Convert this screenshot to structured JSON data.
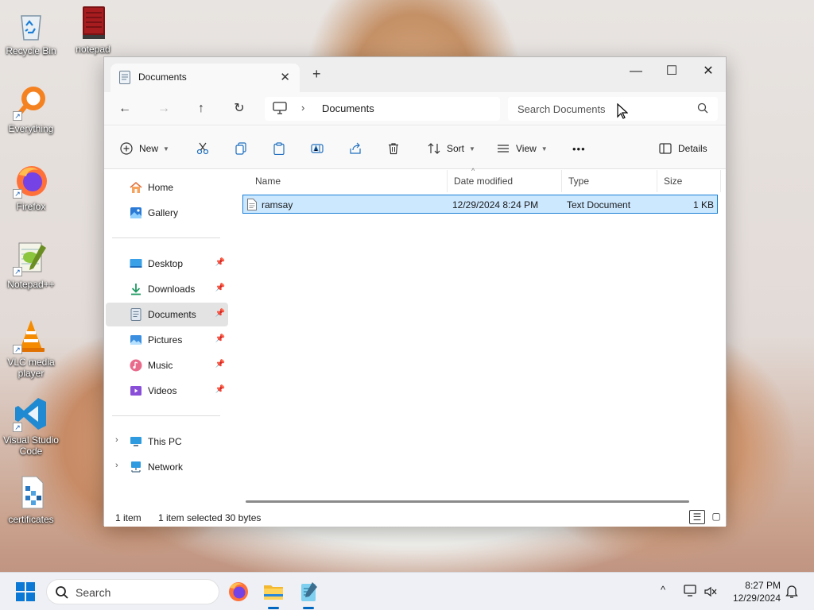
{
  "desktop": {
    "icons": [
      {
        "label": "Recycle Bin",
        "icon": "recycle-bin-icon"
      },
      {
        "label": "notepad",
        "icon": "notepad-book-icon"
      },
      {
        "label": "Everything",
        "icon": "everything-search-icon"
      },
      {
        "label": "Firefox",
        "icon": "firefox-icon"
      },
      {
        "label": "Notepad++",
        "icon": "notepadpp-icon"
      },
      {
        "label": "VLC media player",
        "icon": "vlc-cone-icon"
      },
      {
        "label": "Visual Studio Code",
        "icon": "vscode-icon"
      },
      {
        "label": "certificates",
        "icon": "certificates-icon"
      }
    ]
  },
  "window": {
    "tab_title": "Documents",
    "controls": {
      "minimize": "—",
      "maximize": "☐",
      "close": "✕"
    },
    "address": {
      "crumbs": [
        "Documents"
      ],
      "search_placeholder": "Search Documents"
    },
    "toolbar": {
      "new_label": "New",
      "sort_label": "Sort",
      "view_label": "View",
      "more_label": "•••",
      "details_label": "Details"
    },
    "nav": {
      "quick": [
        {
          "label": "Home",
          "icon": "home-icon"
        },
        {
          "label": "Gallery",
          "icon": "gallery-icon"
        }
      ],
      "pinned": [
        {
          "label": "Desktop",
          "icon": "desktop-folder-icon"
        },
        {
          "label": "Downloads",
          "icon": "downloads-icon"
        },
        {
          "label": "Documents",
          "icon": "documents-icon",
          "selected": true
        },
        {
          "label": "Pictures",
          "icon": "pictures-icon"
        },
        {
          "label": "Music",
          "icon": "music-icon"
        },
        {
          "label": "Videos",
          "icon": "videos-icon"
        }
      ],
      "locations": [
        {
          "label": "This PC",
          "icon": "this-pc-icon"
        },
        {
          "label": "Network",
          "icon": "network-icon"
        }
      ]
    },
    "columns": [
      "Name",
      "Date modified",
      "Type",
      "Size"
    ],
    "files": [
      {
        "name": "ramsay",
        "date_modified": "12/29/2024 8:24 PM",
        "type": "Text Document",
        "size": "1 KB",
        "selected": true
      }
    ],
    "status": {
      "item_count": "1 item",
      "selection": "1 item selected",
      "selection_size": "30 bytes"
    }
  },
  "taskbar": {
    "search_placeholder": "Search",
    "clock_time": "8:27 PM",
    "clock_date": "12/29/2024",
    "accent": "#0067c0"
  }
}
